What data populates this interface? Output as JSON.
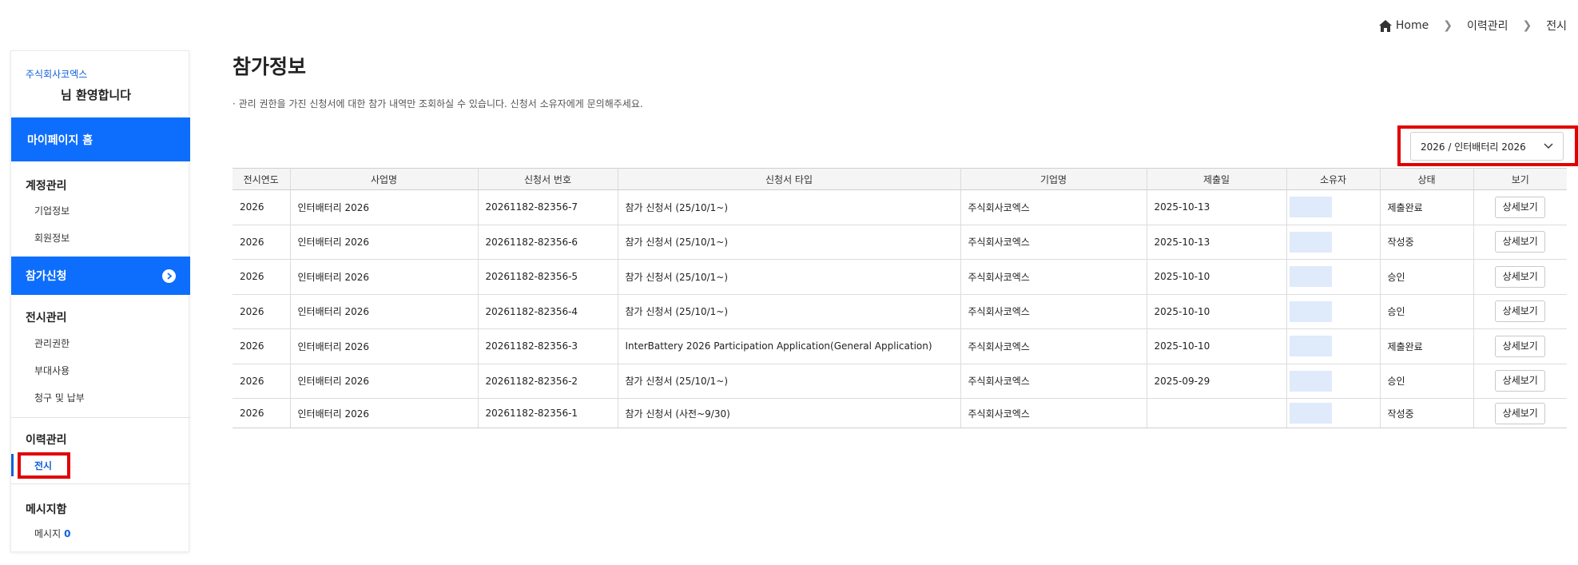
{
  "breadcrumb": {
    "home": "Home",
    "level1": "이력관리",
    "level2": "전시"
  },
  "sidebar": {
    "company": "주식회사코엑스",
    "welcome": "님 환영합니다",
    "mypage_home": "마이페이지 홈",
    "account_section": "계정관리",
    "company_info": "기업정보",
    "member_info": "회원정보",
    "apply": "참가신청",
    "exhibit_section": "전시관리",
    "manage_rights": "관리권한",
    "side_use": "부대사용",
    "billing": "청구 및 납부",
    "history_section": "이력관리",
    "history_exhibit": "전시",
    "message_section": "메시지함",
    "message_label": "메시지",
    "message_count": "0"
  },
  "main": {
    "title": "참가정보",
    "notice": "· 관리 권한을 가진 신청서에 대한 참가 내역만 조회하실 수 있습니다. 신청서 소유자에게 문의해주세요.",
    "select_value": "2026 / 인터배터리 2026"
  },
  "table": {
    "headers": [
      "전시연도",
      "사업명",
      "신청서 번호",
      "신청서 타입",
      "기업명",
      "제출일",
      "소유자",
      "상태",
      "보기"
    ],
    "rows": [
      {
        "year": "2026",
        "project": "인터배터리 2026",
        "number": "20261182-82356-7",
        "type": "참가 신청서 (25/10/1~)",
        "company": "주식회사코엑스",
        "date": "2025-10-13",
        "status": "제출완료",
        "view": "상세보기"
      },
      {
        "year": "2026",
        "project": "인터배터리 2026",
        "number": "20261182-82356-6",
        "type": "참가 신청서 (25/10/1~)",
        "company": "주식회사코엑스",
        "date": "2025-10-13",
        "status": "작성중",
        "view": "상세보기"
      },
      {
        "year": "2026",
        "project": "인터배터리 2026",
        "number": "20261182-82356-5",
        "type": "참가 신청서 (25/10/1~)",
        "company": "주식회사코엑스",
        "date": "2025-10-10",
        "status": "승인",
        "view": "상세보기"
      },
      {
        "year": "2026",
        "project": "인터배터리 2026",
        "number": "20261182-82356-4",
        "type": "참가 신청서 (25/10/1~)",
        "company": "주식회사코엑스",
        "date": "2025-10-10",
        "status": "승인",
        "view": "상세보기"
      },
      {
        "year": "2026",
        "project": "인터배터리 2026",
        "number": "20261182-82356-3",
        "type": "InterBattery 2026 Participation Application(General Application)",
        "company": "주식회사코엑스",
        "date": "2025-10-10",
        "status": "제출완료",
        "view": "상세보기"
      },
      {
        "year": "2026",
        "project": "인터배터리 2026",
        "number": "20261182-82356-2",
        "type": "참가 신청서 (25/10/1~)",
        "company": "주식회사코엑스",
        "date": "2025-09-29",
        "status": "승인",
        "view": "상세보기"
      },
      {
        "year": "2026",
        "project": "인터배터리 2026",
        "number": "20261182-82356-1",
        "type": "참가 신청서 (사전~9/30)",
        "company": "주식회사코엑스",
        "date": "",
        "status": "작성중",
        "view": "상세보기"
      }
    ]
  },
  "colors": {
    "primary": "#0d6efd",
    "highlight": "#e00000",
    "owner_chip": "#dfeafb"
  }
}
